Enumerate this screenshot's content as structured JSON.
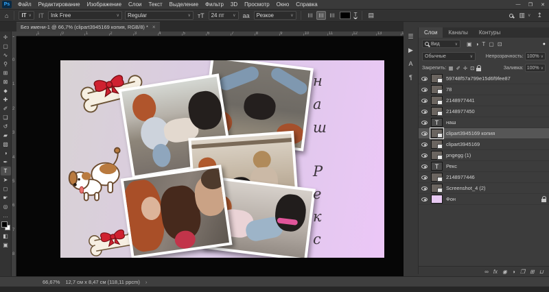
{
  "menu_bar": {
    "items": [
      "Файл",
      "Редактирование",
      "Изображение",
      "Слои",
      "Текст",
      "Выделение",
      "Фильтр",
      "3D",
      "Просмотр",
      "Окно",
      "Справка"
    ],
    "logo": "Ps",
    "window_controls": [
      {
        "name": "minimize-button",
        "glyph": "—"
      },
      {
        "name": "restore-button",
        "glyph": "❐"
      },
      {
        "name": "close-button",
        "glyph": "✕"
      }
    ]
  },
  "options_bar": {
    "home_icon": "⌂",
    "type_tool_icon": "IT",
    "orientation_icon": "IT",
    "font_family": "Ink Free",
    "font_style": "Regular",
    "size_icon": "тT",
    "font_size": "24 пт",
    "aa_icon": "aa",
    "anti_alias": "Резкое",
    "align_icons": [
      {
        "name": "align-top-icon",
        "active": false
      },
      {
        "name": "align-center-icon",
        "active": true
      },
      {
        "name": "align-bottom-icon",
        "active": false
      }
    ],
    "workspace_icon": "▥",
    "share_icon": "↥"
  },
  "document_tab": {
    "title": "Без имени-1 @ 66,7% (clipart3945169 копия, RGB/8) *",
    "close": "×"
  },
  "rulers": {
    "horizontal": [
      "2",
      "1",
      "0",
      "1",
      "2",
      "3",
      "4",
      "5",
      "6",
      "7",
      "8",
      "9",
      "10",
      "11",
      "12",
      "13",
      "14"
    ],
    "vertical": [
      "1",
      "0",
      "1",
      "2",
      "3",
      "4",
      "5",
      "6",
      "7",
      "8",
      "9"
    ]
  },
  "toolbar": {
    "tools": [
      {
        "name": "move-tool",
        "glyph": "✛"
      },
      {
        "name": "marquee-tool",
        "glyph": "▢"
      },
      {
        "name": "lasso-tool",
        "glyph": "∿"
      },
      {
        "name": "quick-selection-tool",
        "glyph": "⚲"
      },
      {
        "name": "crop-tool",
        "glyph": "⊞"
      },
      {
        "name": "frame-tool",
        "glyph": "⊠"
      },
      {
        "name": "eyedropper-tool",
        "glyph": "⬥"
      },
      {
        "name": "healing-brush-tool",
        "glyph": "✚"
      },
      {
        "name": "brush-tool",
        "glyph": "✐"
      },
      {
        "name": "clone-stamp-tool",
        "glyph": "❏"
      },
      {
        "name": "history-brush-tool",
        "glyph": "↺"
      },
      {
        "name": "eraser-tool",
        "glyph": "▰"
      },
      {
        "name": "gradient-tool",
        "glyph": "▧"
      },
      {
        "name": "dodge-tool",
        "glyph": "◑"
      },
      {
        "name": "pen-tool",
        "glyph": "✒"
      },
      {
        "name": "type-tool",
        "glyph": "T",
        "active": true
      },
      {
        "name": "path-selection-tool",
        "glyph": "➤"
      },
      {
        "name": "shape-tool",
        "glyph": "◻"
      },
      {
        "name": "hand-tool",
        "glyph": "☛"
      },
      {
        "name": "zoom-tool",
        "glyph": "◎"
      },
      {
        "name": "edit-toolbar",
        "glyph": "…"
      },
      {
        "name": "color-swatches",
        "type": "colors"
      },
      {
        "name": "quick-mask-mode",
        "glyph": "◧"
      },
      {
        "name": "screen-mode",
        "glyph": "▣"
      }
    ]
  },
  "canvas": {
    "text_top": "наш",
    "text_bottom": "Рекс"
  },
  "right_dock": [
    {
      "name": "properties-panel-icon",
      "glyph": "☰"
    },
    {
      "name": "actions-panel-icon",
      "glyph": "▶"
    },
    {
      "name": "character-panel-icon",
      "glyph": "A"
    },
    {
      "name": "paragraph-panel-icon",
      "glyph": "¶"
    }
  ],
  "layers_panel": {
    "tabs": [
      {
        "label": "Слои",
        "active": true
      },
      {
        "label": "Каналы",
        "active": false
      },
      {
        "label": "Контуры",
        "active": false
      }
    ],
    "search_label": "Вид",
    "filter_icons": [
      {
        "name": "filter-pixel-layers-icon",
        "glyph": "▣"
      },
      {
        "name": "filter-adjustment-layers-icon",
        "glyph": "◑"
      },
      {
        "name": "filter-type-layers-icon",
        "glyph": "T"
      },
      {
        "name": "filter-shape-layers-icon",
        "glyph": "▢"
      },
      {
        "name": "filter-smart-objects-icon",
        "glyph": "⊡"
      }
    ],
    "filter_toggle": "●",
    "blend_mode": "Обычные",
    "opacity_label": "Непрозрачность:",
    "opacity_value": "100%",
    "lock_label": "Закрепить:",
    "lock_icons": [
      {
        "name": "lock-transparency-icon",
        "glyph": "▦"
      },
      {
        "name": "lock-paint-icon",
        "glyph": "✐"
      },
      {
        "name": "lock-position-icon",
        "glyph": "✛"
      },
      {
        "name": "lock-artboard-icon",
        "glyph": "⊡"
      }
    ],
    "fill_label": "Заливка:",
    "fill_value": "100%",
    "layers": [
      {
        "name": "59748f57a799e15d6f9fee87",
        "type": "smart"
      },
      {
        "name": "78",
        "type": "smart"
      },
      {
        "name": "2148977441",
        "type": "smart"
      },
      {
        "name": "2148977450",
        "type": "smart"
      },
      {
        "name": "наш",
        "type": "text"
      },
      {
        "name": "clipart3945169 копия",
        "type": "smart",
        "selected": true
      },
      {
        "name": "clipart3945169",
        "type": "smart"
      },
      {
        "name": "pngegg (1)",
        "type": "smart"
      },
      {
        "name": "Рекс",
        "type": "text"
      },
      {
        "name": "2148977446",
        "type": "smart"
      },
      {
        "name": "Screenshot_4 (2)",
        "type": "smart"
      },
      {
        "name": "Фон",
        "type": "background",
        "locked": true
      }
    ],
    "bottom_icons": [
      {
        "name": "link-layers-icon",
        "glyph": "∞"
      },
      {
        "name": "layer-effects-icon",
        "glyph": "fx"
      },
      {
        "name": "add-layer-mask-icon",
        "glyph": "◉"
      },
      {
        "name": "adjustment-layer-icon",
        "glyph": "◑"
      },
      {
        "name": "new-group-icon",
        "glyph": "❐"
      },
      {
        "name": "new-layer-icon",
        "glyph": "⊞"
      },
      {
        "name": "delete-layer-icon",
        "glyph": "⊔"
      }
    ]
  },
  "status_bar": {
    "zoom": "66,67%",
    "doc_info": "12,7 см x 8,47 см (118,11 ppcm)",
    "chevron": "›"
  }
}
